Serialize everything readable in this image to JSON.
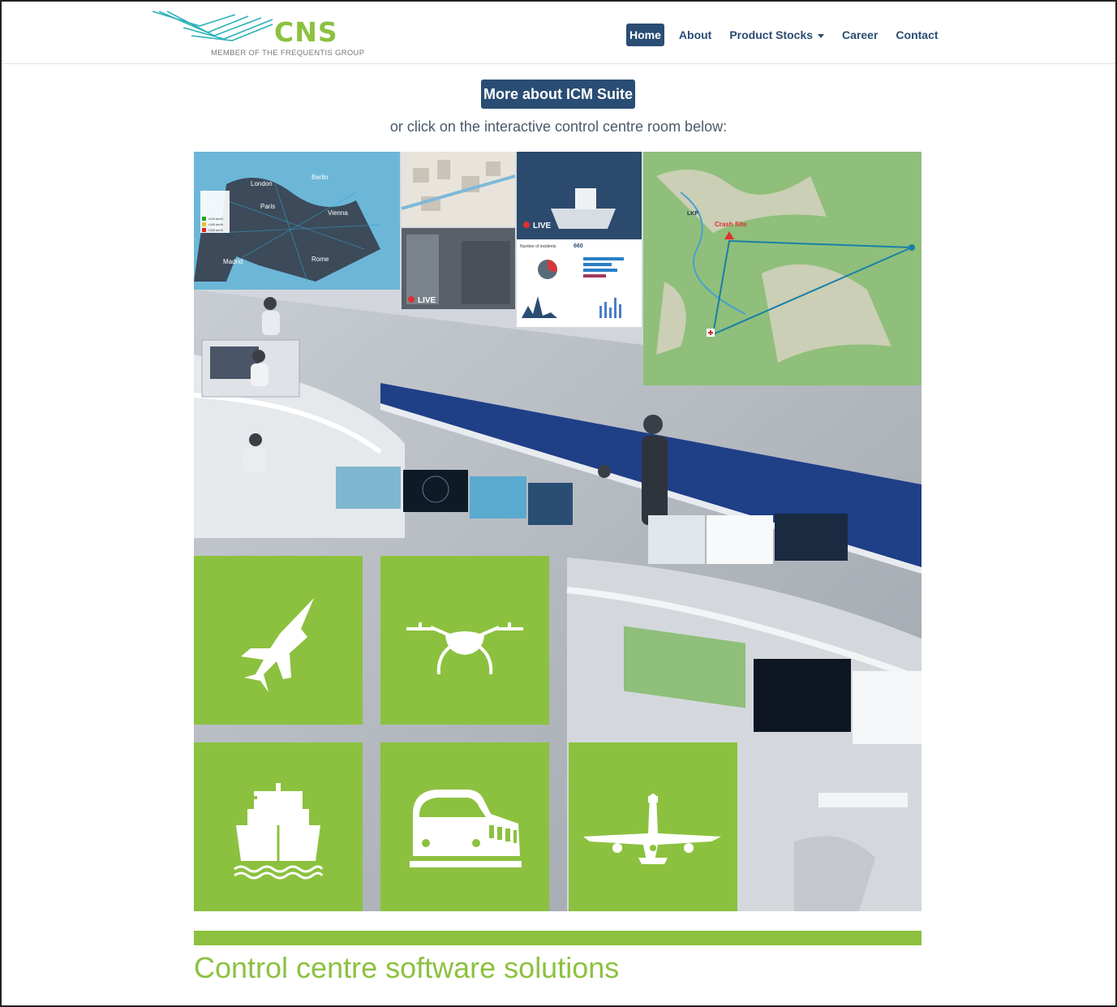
{
  "brand": {
    "name": "CNS",
    "tagline": "MEMBER OF THE FREQUENTIS GROUP",
    "color": "#8cc13f"
  },
  "nav": {
    "items": [
      {
        "label": "Home",
        "active": true
      },
      {
        "label": "About"
      },
      {
        "label": "Product Stocks",
        "dropdown": true
      },
      {
        "label": "Career"
      },
      {
        "label": "Contact"
      }
    ]
  },
  "cta": {
    "label": "More about ICM Suite",
    "color": "#2a4d74"
  },
  "subline": "or click on the interactive control centre room below:",
  "scene": {
    "live_badge": "LIVE",
    "map_labels": {
      "london": "London",
      "berlin": "Berlin",
      "paris": "Paris",
      "vienna": "Vienna",
      "madrid": "Madrid",
      "rome": "Rome"
    },
    "speed_legend": [
      "<120 km/h",
      "<160 km/h",
      ">220 km/h"
    ],
    "dashboard": {
      "title": "Number of incidents",
      "total": "660"
    },
    "tactical_map": {
      "crash_site": "Crash Site",
      "lkp": "LKP"
    }
  },
  "tiles": [
    {
      "name": "military-aviation",
      "icon": "fighter-jet-icon"
    },
    {
      "name": "drones",
      "icon": "drone-icon"
    },
    {
      "name": "maritime",
      "icon": "ship-icon"
    },
    {
      "name": "railway",
      "icon": "train-icon"
    },
    {
      "name": "civil-aviation",
      "icon": "airplane-icon"
    }
  ],
  "section": {
    "title": "Control centre software solutions"
  }
}
